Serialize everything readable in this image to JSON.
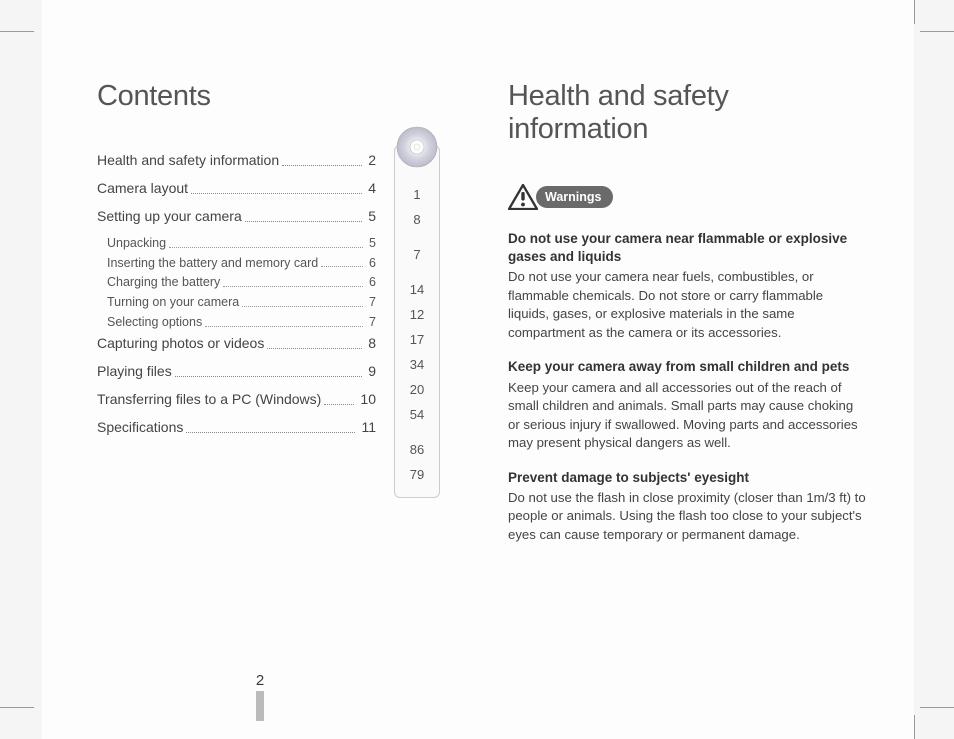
{
  "left": {
    "title": "Contents",
    "toc": [
      {
        "label": "Health and safety information",
        "page": "2",
        "sub": false
      },
      {
        "label": "Camera layout",
        "page": "4",
        "sub": false
      },
      {
        "label": "Setting up your camera",
        "page": "5",
        "sub": false
      },
      {
        "label": "Unpacking",
        "page": "5",
        "sub": true
      },
      {
        "label": "Inserting the battery and memory card",
        "page": "6",
        "sub": true
      },
      {
        "label": "Charging the battery",
        "page": "6",
        "sub": true
      },
      {
        "label": "Turning on your camera",
        "page": "7",
        "sub": true
      },
      {
        "label": "Selecting options",
        "page": "7",
        "sub": true
      },
      {
        "label": "Capturing photos or videos",
        "page": "8",
        "sub": false
      },
      {
        "label": "Playing files",
        "page": "9",
        "sub": false
      },
      {
        "label": "Transferring files to a PC (Windows)",
        "page": "10",
        "sub": false
      },
      {
        "label": "Specifications",
        "page": "11",
        "sub": false
      }
    ],
    "cd_pages": [
      "1",
      "8",
      "",
      "7",
      "",
      "14",
      "12",
      "17",
      "34",
      "20",
      "54",
      "",
      "86",
      "79"
    ],
    "page_number": "2"
  },
  "right": {
    "title": "Health and safety information",
    "warnings_label": "Warnings",
    "sections": [
      {
        "head": "Do not use your camera near flammable or explosive gases and liquids",
        "body": "Do not use your camera near fuels, combustibles, or flammable chemicals. Do not store or carry flammable liquids, gases, or explosive materials in the same compartment as the camera or its accessories."
      },
      {
        "head": "Keep your camera away from small children and pets",
        "body": "Keep your camera and all accessories out of the reach of small children and animals. Small parts may cause choking or serious injury if swallowed. Moving parts and accessories may present physical dangers as well."
      },
      {
        "head": "Prevent damage to subjects' eyesight",
        "body": "Do not use the flash in close proximity (closer than 1m/3 ft) to people or animals. Using the flash too close to your subject's eyes can cause temporary or permanent damage."
      }
    ]
  }
}
